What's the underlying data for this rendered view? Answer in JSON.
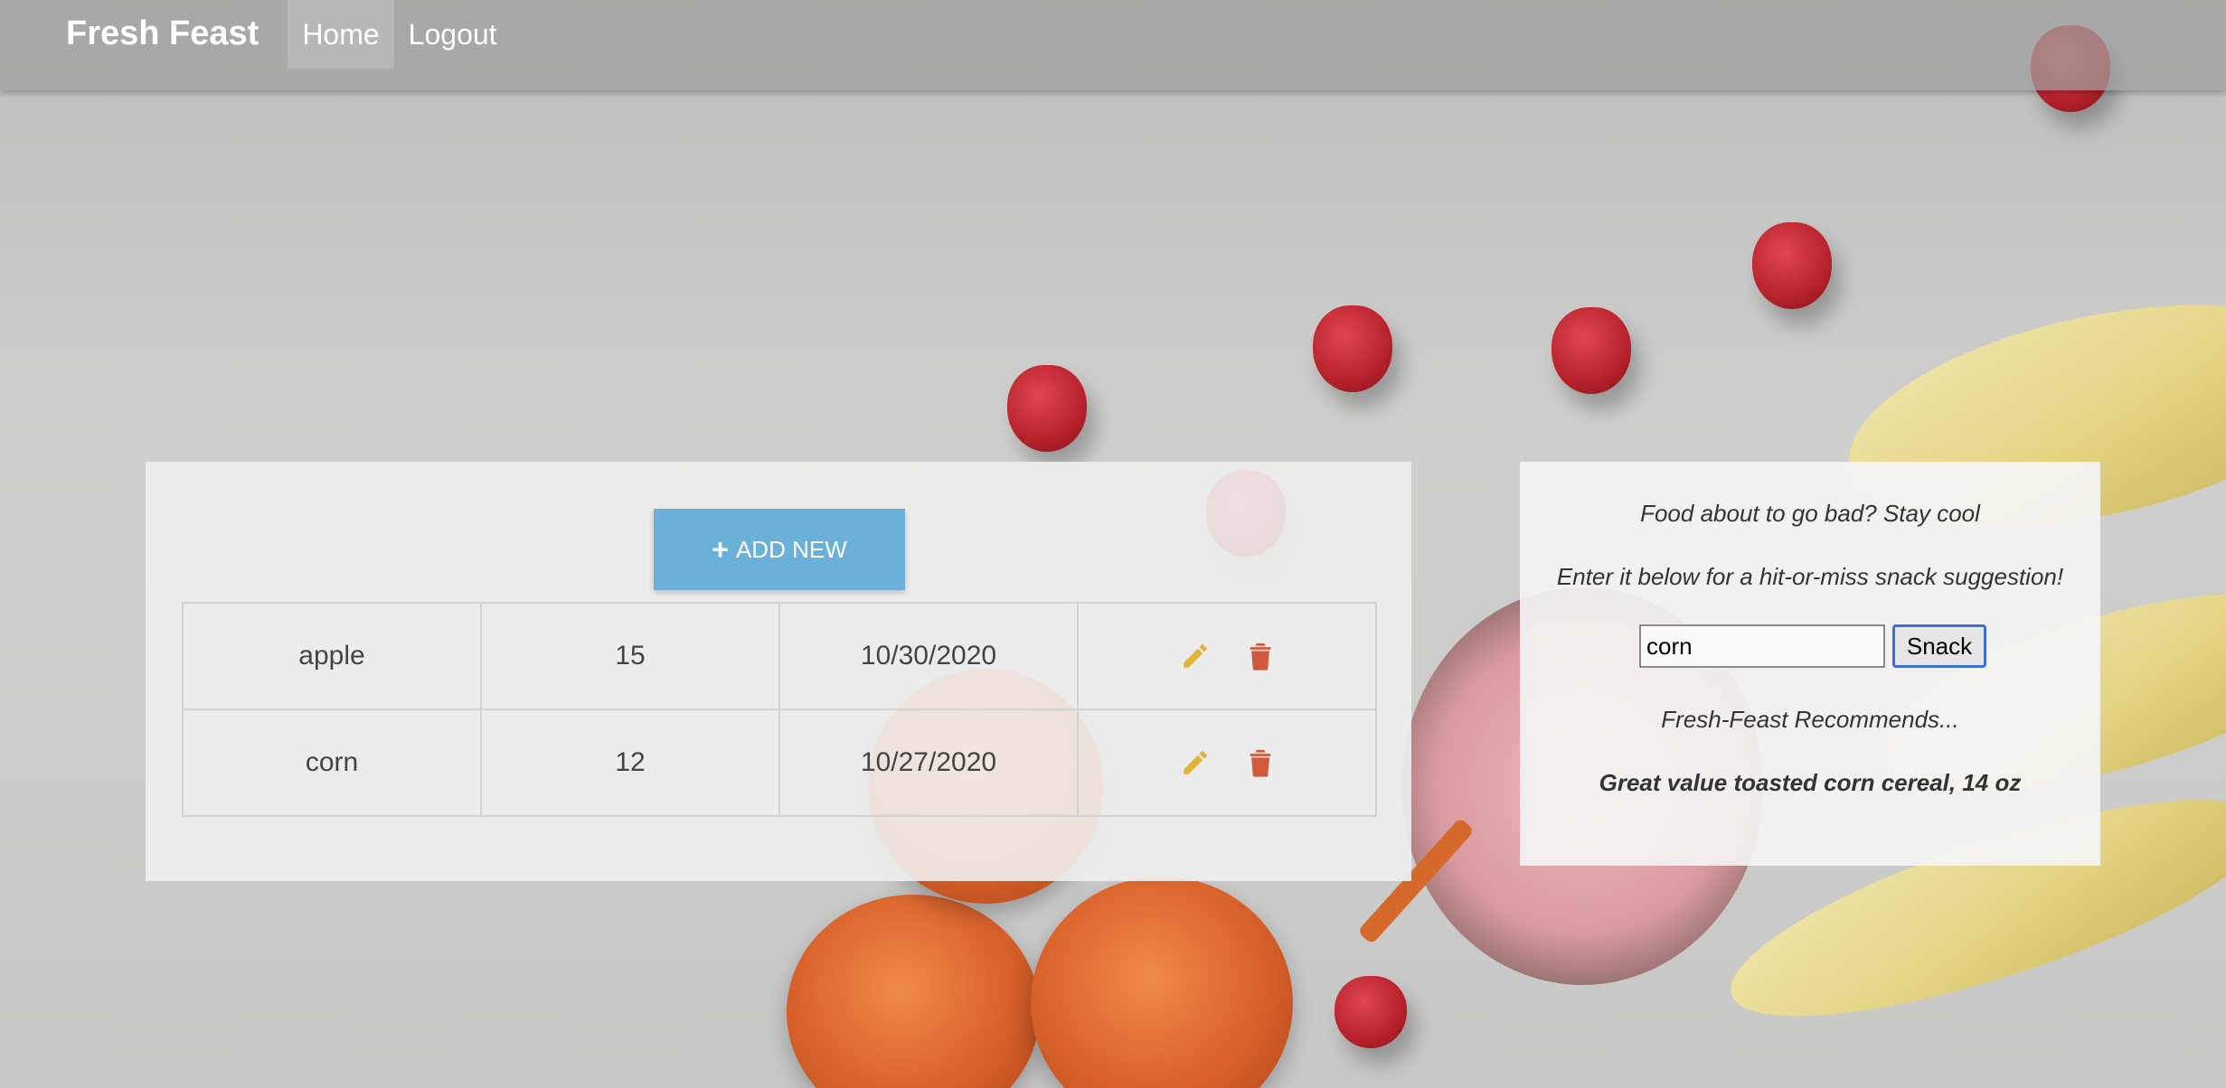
{
  "nav": {
    "brand": "Fresh Feast",
    "links": [
      {
        "label": "Home",
        "active": true
      },
      {
        "label": "Logout",
        "active": false
      }
    ]
  },
  "inventory": {
    "add_label": "ADD NEW",
    "rows": [
      {
        "name": "apple",
        "quantity": "15",
        "date": "10/30/2020"
      },
      {
        "name": "corn",
        "quantity": "12",
        "date": "10/27/2020"
      }
    ]
  },
  "snack": {
    "line1": "Food about to go bad? Stay cool",
    "line2": "Enter it below for a hit-or-miss snack suggestion!",
    "input_value": "corn",
    "button_label": "Snack",
    "recommend_heading": "Fresh-Feast Recommends...",
    "recommendation": "Great value toasted corn cereal, 14 oz"
  },
  "colors": {
    "edit_icon": "#e2b33a",
    "delete_icon": "#cf5b3c",
    "add_button": "#6ab0d9"
  },
  "icons": {
    "edit": "pencil-icon",
    "delete": "trash-icon",
    "add": "plus-icon"
  }
}
